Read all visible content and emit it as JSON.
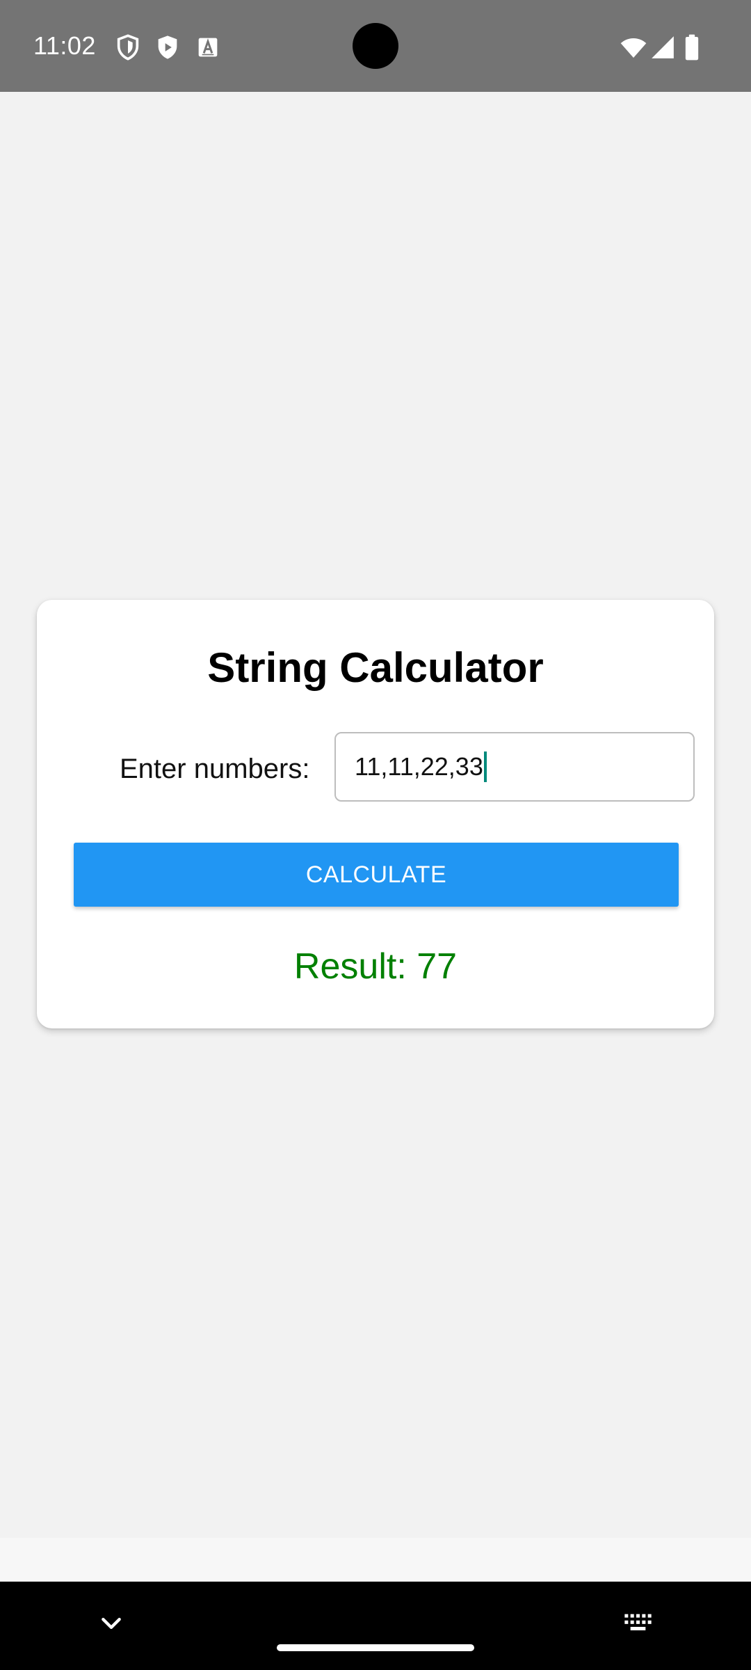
{
  "status_bar": {
    "time": "11:02",
    "left_icons": [
      "shield-outline-icon",
      "play-shield-icon",
      "font-a-icon"
    ],
    "right_icons": [
      "wifi-icon",
      "cell-signal-icon",
      "battery-icon"
    ]
  },
  "app": {
    "title": "String Calculator",
    "input_label": "Enter numbers:",
    "input_value": "11,11,22,33",
    "button_label": "CALCULATE",
    "result_text": "Result: 77"
  },
  "nav_bar": {
    "icons": [
      "chevron-down-icon",
      "keyboard-icon",
      "home-gesture-pill"
    ]
  },
  "colors": {
    "status_bar_bg": "#747474",
    "page_bg": "#f2f2f2",
    "card_bg": "#ffffff",
    "button_bg": "#2196f3",
    "button_text": "#ffffff",
    "result_text": "#008000",
    "caret": "#00897b",
    "nav_bar_bg": "#000000"
  }
}
